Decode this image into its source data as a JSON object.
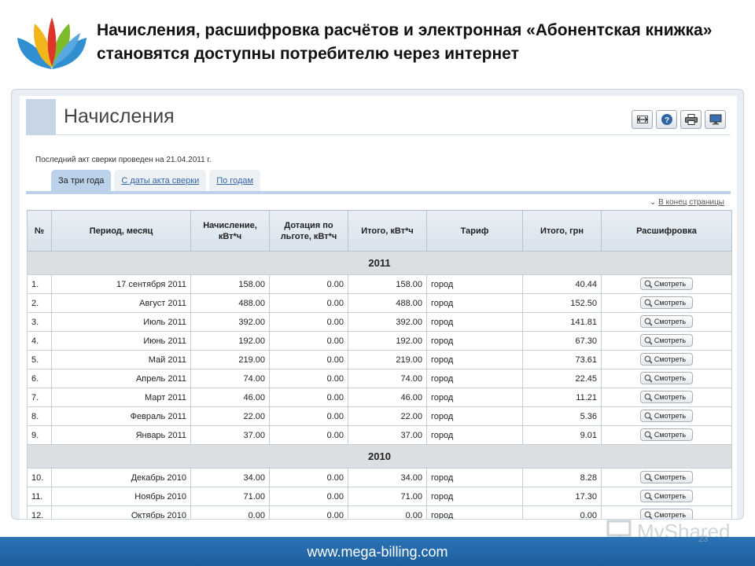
{
  "slide": {
    "title": "Начисления, расшифровка расчётов и электронная «Абонентская книжка» становятся доступны потребителю через интернет",
    "footer_site": "www.mega-billing.com",
    "watermark": "MyShared",
    "slide_number": "23"
  },
  "colors": {
    "footer": "#2a73b6",
    "tab_active": "#bcd2ea",
    "header_bar": "#c6d6e6",
    "year_row": "#dcdfe2"
  },
  "page": {
    "title": "Начисления",
    "tools": [
      "resize-icon",
      "help-icon",
      "print-icon",
      "monitor-icon"
    ],
    "recon_text": "Последний акт сверки проведен на 21.04.2011 г.",
    "tabs": [
      "За три года",
      "С даты акта сверки",
      "По годам"
    ],
    "to_end_link": "В конец страницы"
  },
  "table": {
    "headers": [
      "№",
      "Период, месяц",
      "Начисление, кВт*ч",
      "Дотация по льготе, кВт*ч",
      "Итого, кВт*ч",
      "Тариф",
      "Итого, грн",
      "Расшифровка"
    ],
    "view_label": "Смотреть",
    "groups": [
      {
        "year": "2011",
        "rows": [
          {
            "n": "1.",
            "period": "17 сентября 2011",
            "charge": "158.00",
            "subsidy": "0.00",
            "total": "158.00",
            "tariff": "город",
            "uah": "40.44"
          },
          {
            "n": "2.",
            "period": "Август 2011",
            "charge": "488.00",
            "subsidy": "0.00",
            "total": "488.00",
            "tariff": "город",
            "uah": "152.50"
          },
          {
            "n": "3.",
            "period": "Июль 2011",
            "charge": "392.00",
            "subsidy": "0.00",
            "total": "392.00",
            "tariff": "город",
            "uah": "141.81"
          },
          {
            "n": "4.",
            "period": "Июнь 2011",
            "charge": "192.00",
            "subsidy": "0.00",
            "total": "192.00",
            "tariff": "город",
            "uah": "67.30"
          },
          {
            "n": "5.",
            "period": "Май 2011",
            "charge": "219.00",
            "subsidy": "0.00",
            "total": "219.00",
            "tariff": "город",
            "uah": "73.61"
          },
          {
            "n": "6.",
            "period": "Апрель 2011",
            "charge": "74.00",
            "subsidy": "0.00",
            "total": "74.00",
            "tariff": "город",
            "uah": "22.45"
          },
          {
            "n": "7.",
            "period": "Март 2011",
            "charge": "46.00",
            "subsidy": "0.00",
            "total": "46.00",
            "tariff": "город",
            "uah": "11.21"
          },
          {
            "n": "8.",
            "period": "Февраль 2011",
            "charge": "22.00",
            "subsidy": "0.00",
            "total": "22.00",
            "tariff": "город",
            "uah": "5.36"
          },
          {
            "n": "9.",
            "period": "Январь 2011",
            "charge": "37.00",
            "subsidy": "0.00",
            "total": "37.00",
            "tariff": "город",
            "uah": "9.01"
          }
        ]
      },
      {
        "year": "2010",
        "rows": [
          {
            "n": "10.",
            "period": "Декабрь 2010",
            "charge": "34.00",
            "subsidy": "0.00",
            "total": "34.00",
            "tariff": "город",
            "uah": "8.28"
          },
          {
            "n": "11.",
            "period": "Ноябрь 2010",
            "charge": "71.00",
            "subsidy": "0.00",
            "total": "71.00",
            "tariff": "город",
            "uah": "17.30"
          },
          {
            "n": "12.",
            "period": "Октябрь 2010",
            "charge": "0.00",
            "subsidy": "0.00",
            "total": "0.00",
            "tariff": "город",
            "uah": "0.00"
          }
        ]
      }
    ]
  }
}
